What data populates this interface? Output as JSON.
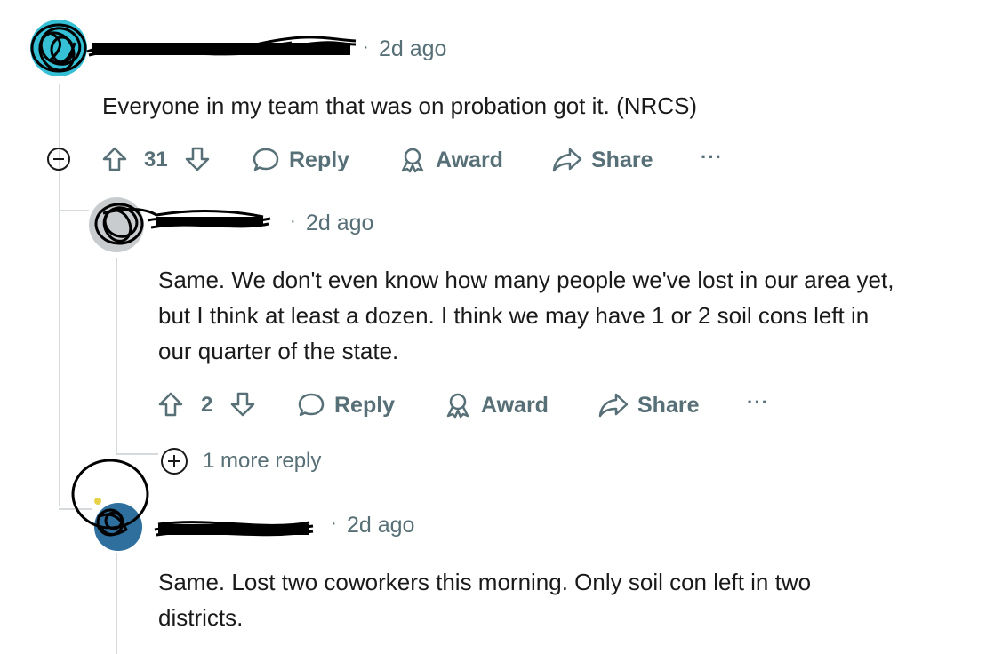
{
  "comments": [
    {
      "time": "2d ago",
      "body": [
        "Everyone in my team that was on probation got it. (NRCS)"
      ],
      "votes": "31",
      "reply_label": "Reply",
      "award_label": "Award",
      "share_label": "Share",
      "more_label": "···"
    },
    {
      "time": "2d ago",
      "body": [
        "Same. We don't even know how many people we've lost in our area yet,",
        "but I think at least a dozen. I think we may have 1 or 2 soil cons left in",
        "our quarter of the state."
      ],
      "votes": "2",
      "reply_label": "Reply",
      "award_label": "Award",
      "share_label": "Share",
      "more_label": "···",
      "more_replies": "1 more reply"
    },
    {
      "time": "2d ago",
      "body": [
        "Same. Lost two coworkers this morning. Only soil con left in two",
        "districts."
      ]
    }
  ],
  "separator": "·",
  "icons": [
    "minus-circle-icon",
    "upvote-icon",
    "downvote-icon",
    "comment-bubble-icon",
    "award-ribbon-icon",
    "share-arrow-icon",
    "overflow-dots-icon",
    "plus-circle-icon"
  ],
  "colors": {
    "text": "#1a1a1b",
    "meta": "#576f76",
    "thread": "#d7dadc",
    "avatar_teal": "#35c0d6"
  }
}
